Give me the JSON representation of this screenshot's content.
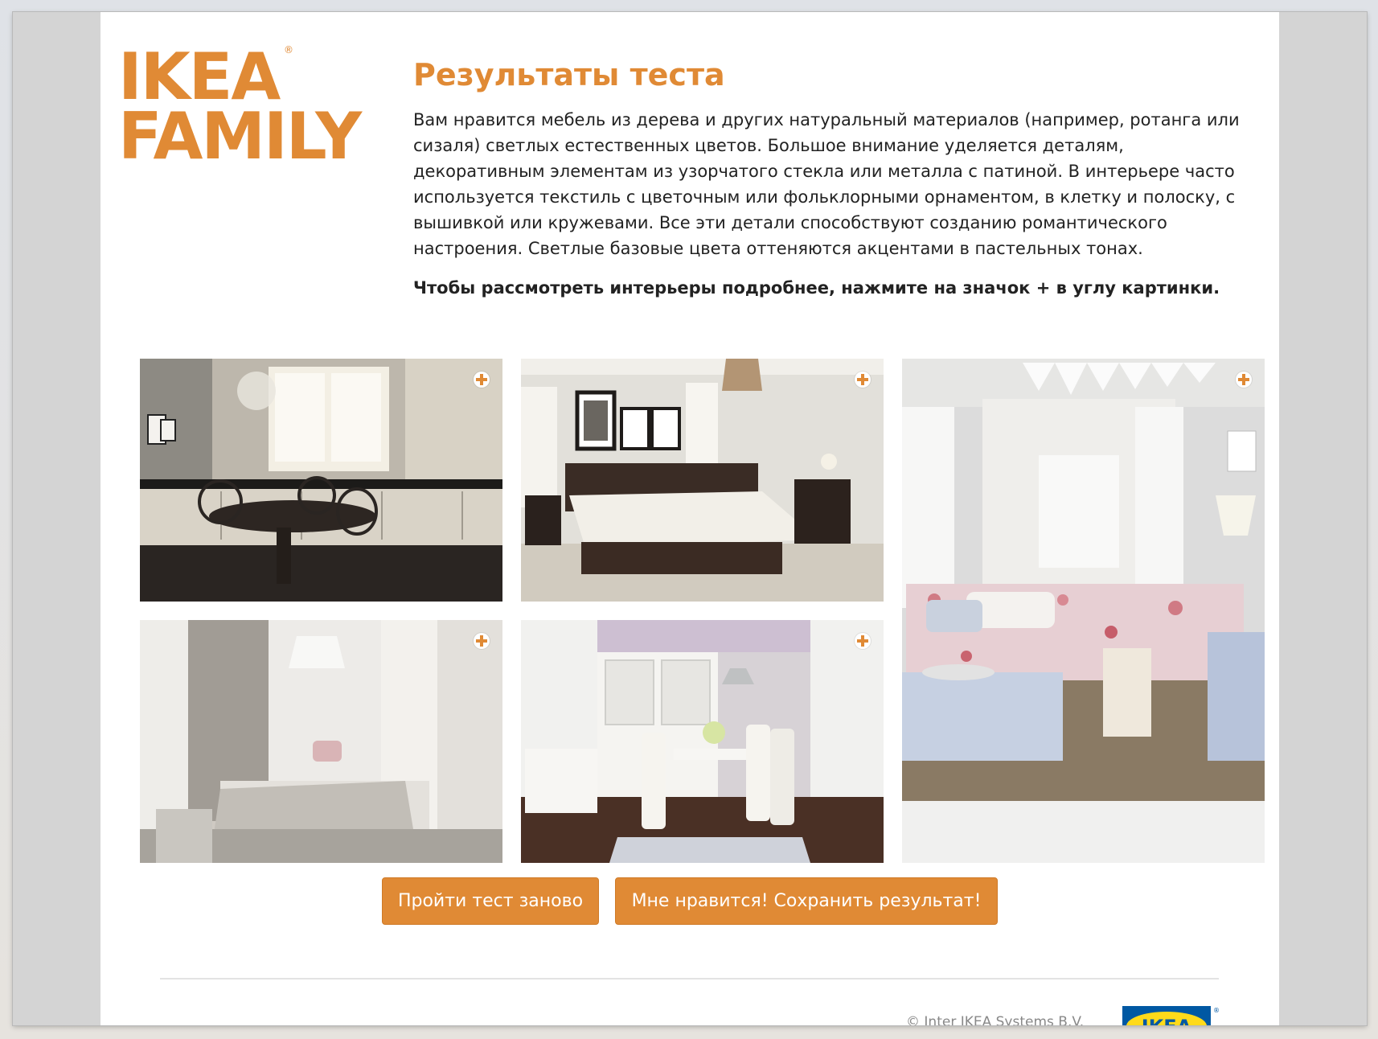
{
  "logo": {
    "line1": "IKEA",
    "line2": "FAMILY",
    "registered": "®"
  },
  "result": {
    "title": "Результаты теста",
    "description": "Вам нравится мебель из дерева и других натуральный материалов (например, ротанга или сизаля) светлых естественных цветов. Большое внимание уделяется деталям, декоративным элементам из узорчатого стекла или металла с патиной. В интерьере часто используется текстиль с цветочным или фольклорными орнаментом, в клетку и полоску, с вышивкой или кружевами. Все эти детали способствуют созданию романтического настроения. Светлые базовые цвета оттеняются акцентами в пастельных тонах.",
    "hint": "Чтобы рассмотреть интерьеры подробнее, нажмите на значок + в углу картинки."
  },
  "gallery": [
    {
      "subject": "kitchen-dining",
      "expand_icon": "plus-circle-icon"
    },
    {
      "subject": "bedroom",
      "expand_icon": "plus-circle-icon"
    },
    {
      "subject": "living-room-floral-sofa",
      "expand_icon": "plus-circle-icon"
    },
    {
      "subject": "canopy-bedroom",
      "expand_icon": "plus-circle-icon"
    },
    {
      "subject": "dining-room",
      "expand_icon": "plus-circle-icon"
    }
  ],
  "buttons": {
    "retake": "Пройти тест заново",
    "save": "Мне нравится! Сохранить результат!"
  },
  "footer": {
    "copyright": "© Inter IKEA Systems B.V.",
    "brand_logo_text": "IKEA"
  },
  "colors": {
    "accent": "#e08a35",
    "ikea_blue": "#0058a3",
    "ikea_yellow": "#ffda1a"
  }
}
